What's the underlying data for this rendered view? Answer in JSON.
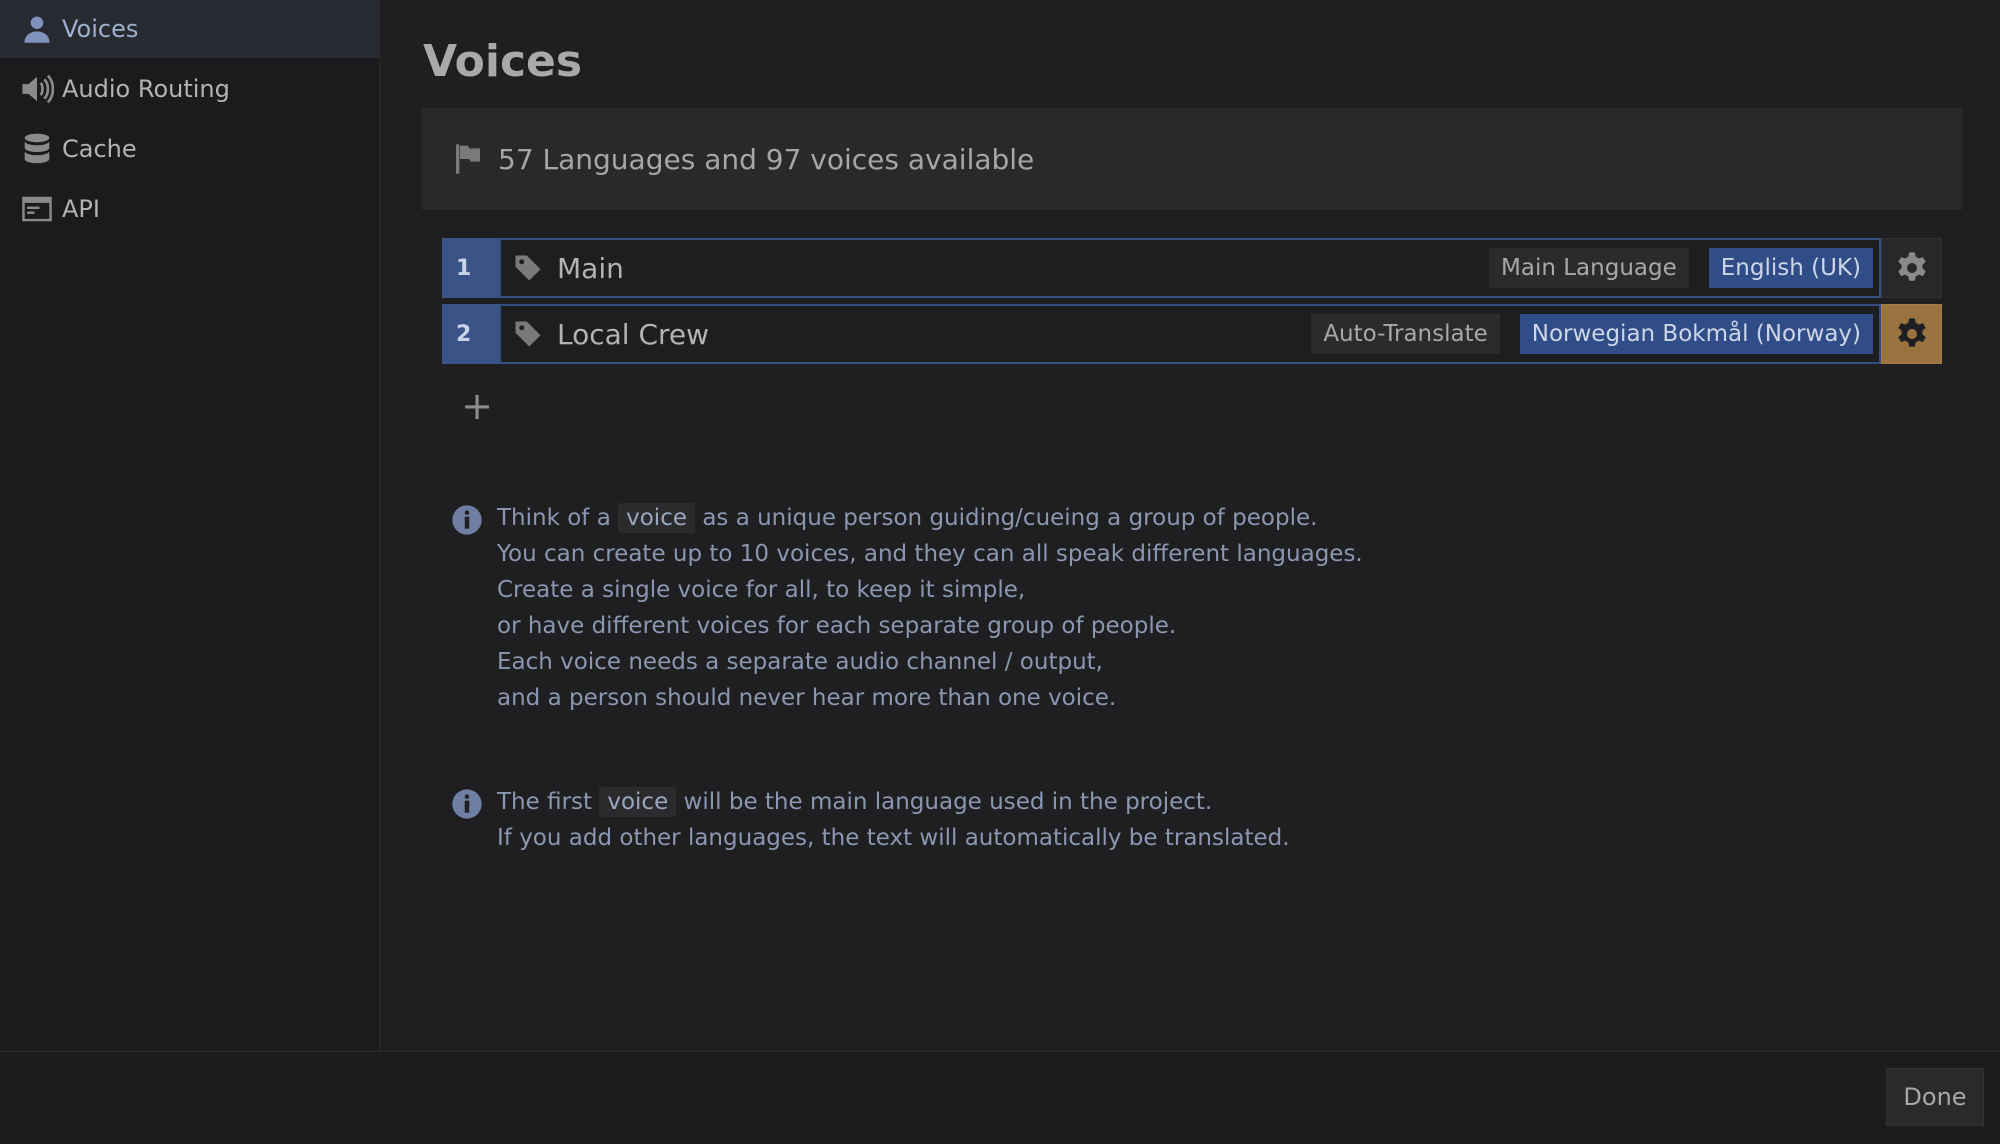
{
  "sidebar": {
    "items": [
      {
        "label": "Voices",
        "icon": "user-icon",
        "active": true
      },
      {
        "label": "Audio Routing",
        "icon": "speaker-icon"
      },
      {
        "label": "Cache",
        "icon": "database-icon"
      },
      {
        "label": "API",
        "icon": "terminal-window-icon"
      }
    ]
  },
  "main": {
    "title": "Voices",
    "summary": "57 Languages and 97 voices available",
    "voices": [
      {
        "number": "1",
        "name": "Main",
        "mode": "Main Language",
        "language": "English (UK)"
      },
      {
        "number": "2",
        "name": "Local Crew",
        "mode": "Auto-Translate",
        "language": "Norwegian Bokmål (Norway)"
      }
    ],
    "add_label": "+",
    "info1": {
      "pre": "Think of a",
      "code": "voice",
      "post": "as a unique person guiding/cueing a group of people.",
      "lines": [
        "You can create up to 10 voices, and they can all speak different languages.",
        "Create a single voice for all, to keep it simple,",
        "or have different voices for each separate group of people.",
        "Each voice needs a separate audio channel / output,",
        "and a person should never hear more than one voice."
      ]
    },
    "info2": {
      "pre": "The first",
      "code": "voice",
      "post": "will be the main language used in the project.",
      "lines": [
        "If you add other languages, the text will automatically be translated."
      ]
    }
  },
  "footer": {
    "done_label": "Done"
  },
  "colors": {
    "accent_blue": "#3a5488",
    "accent_orange": "#9a7340",
    "bg": "#1f1f21"
  }
}
